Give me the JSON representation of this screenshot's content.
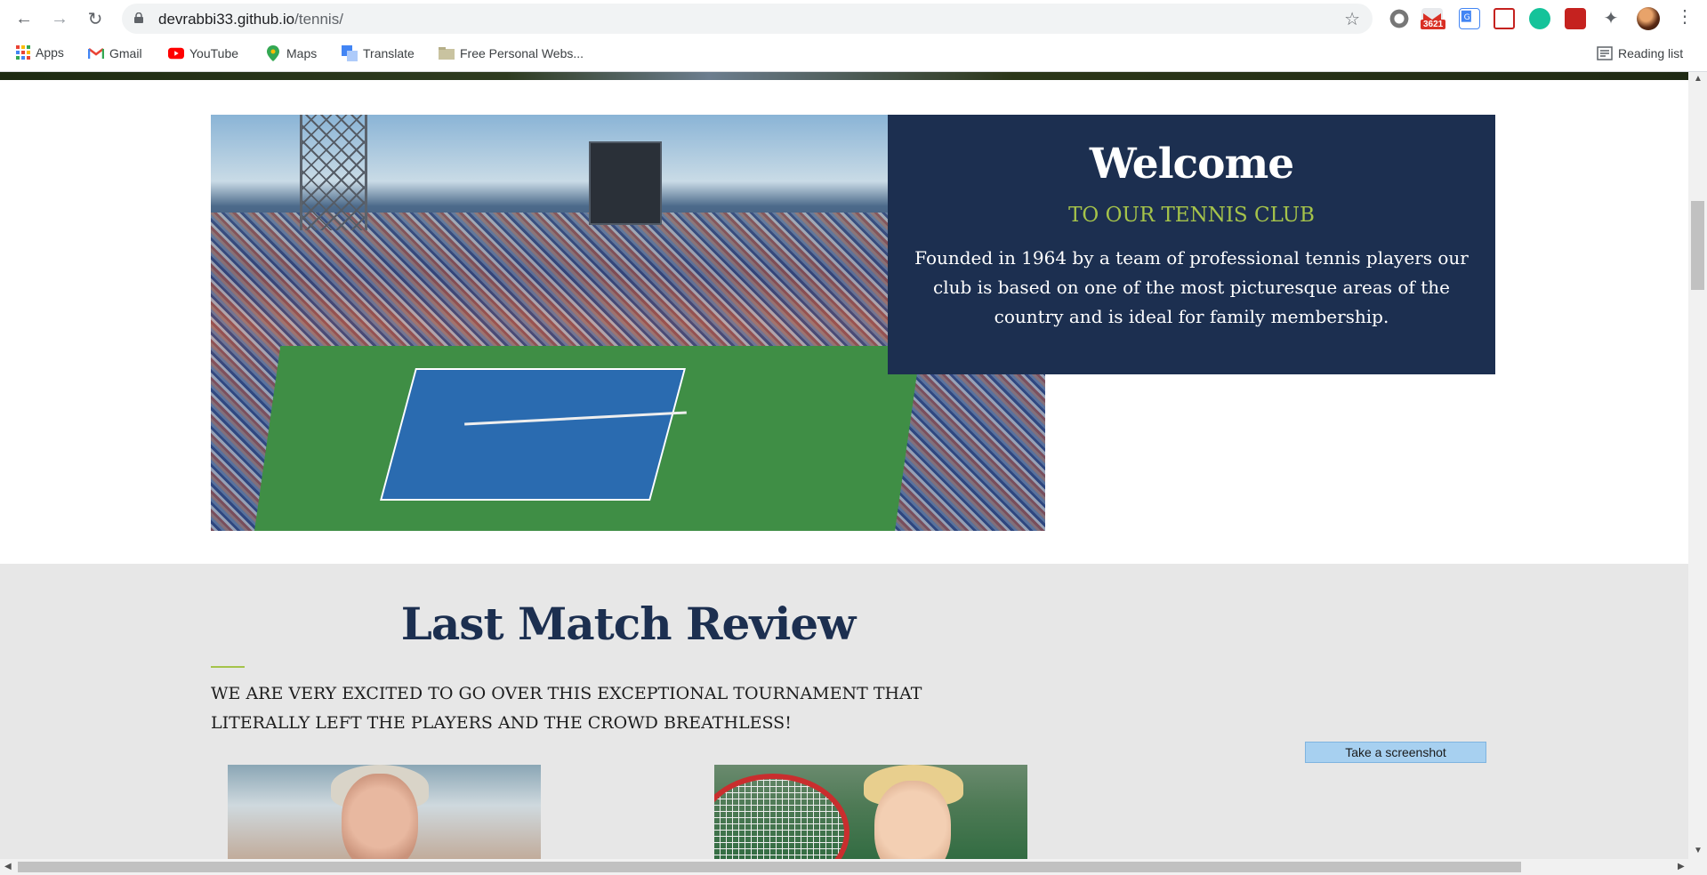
{
  "browser": {
    "url_host": "devrabbi33.github.io",
    "url_path": "/tennis/",
    "mail_badge": "3621",
    "bookmarks": [
      {
        "label": "Apps",
        "icon": "apps-grid-icon"
      },
      {
        "label": "Gmail",
        "icon": "gmail-icon"
      },
      {
        "label": "YouTube",
        "icon": "youtube-icon"
      },
      {
        "label": "Maps",
        "icon": "maps-icon"
      },
      {
        "label": "Translate",
        "icon": "translate-icon"
      },
      {
        "label": "Free Personal Webs...",
        "icon": "folder-icon"
      }
    ],
    "reading_list": "Reading list"
  },
  "welcome": {
    "title": "Welcome",
    "subtitle": "TO OUR TENNIS CLUB",
    "text": "Founded in 1964 by a team of professional tennis players our club is based on one of the most picturesque areas of the country and is ideal for family membership."
  },
  "review": {
    "title": "Last Match Review",
    "text": "WE ARE VERY EXCITED TO GO OVER THIS EXCEPTIONAL TOURNAMENT THAT LITERALLY LEFT THE PLAYERS AND THE CROWD BREATHLESS!"
  },
  "overlay": {
    "screenshot_button": "Take a screenshot"
  },
  "colors": {
    "navy": "#1c2f50",
    "accent_green": "#a5c34a",
    "review_bg": "#e7e7e7"
  }
}
